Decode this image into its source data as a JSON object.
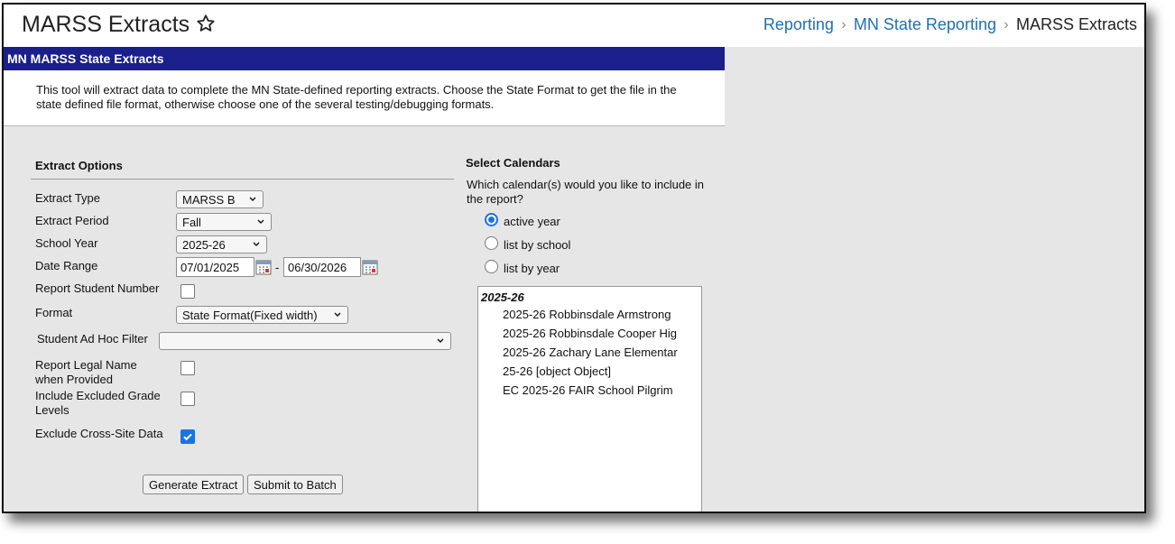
{
  "header": {
    "title": "MARSS Extracts",
    "breadcrumb": [
      "Reporting",
      "MN State Reporting",
      "MARSS Extracts"
    ]
  },
  "panel": {
    "title": "MN MARSS State Extracts",
    "description": "This tool will extract data to complete the MN State-defined reporting extracts. Choose the State Format to get the file in the state defined file format, otherwise choose one of the several testing/debugging formats."
  },
  "extract_options": {
    "section_title": "Extract Options",
    "extract_type": {
      "label": "Extract Type",
      "value": "MARSS B"
    },
    "extract_period": {
      "label": "Extract Period",
      "value": "Fall"
    },
    "school_year": {
      "label": "School Year",
      "value": "2025-26"
    },
    "date_range": {
      "label": "Date Range",
      "start": "07/01/2025",
      "separator": "-",
      "end": "06/30/2026"
    },
    "report_student_number": {
      "label": "Report Student Number",
      "checked": false
    },
    "format": {
      "label": "Format",
      "value": "State Format(Fixed width)"
    },
    "student_ad_hoc_filter": {
      "label": "Student Ad Hoc Filter",
      "value": ""
    },
    "report_legal_name": {
      "label_line1": "Report Legal Name",
      "label_line2": "when Provided",
      "checked": false
    },
    "include_excluded_grade": {
      "label_line1": "Include Excluded Grade",
      "label_line2": "Levels",
      "checked": false
    },
    "exclude_cross_site": {
      "label": "Exclude Cross-Site Data",
      "checked": true
    },
    "buttons": {
      "generate": "Generate Extract",
      "submit": "Submit to Batch"
    }
  },
  "calendars": {
    "section_title": "Select Calendars",
    "question_line1": "Which calendar(s) would you like to include in",
    "question_line2": "the report?",
    "options": [
      "active year",
      "list by school",
      "list by year"
    ],
    "selected_option": "active year",
    "group": "2025-26",
    "items": [
      "2025-26 Robbinsdale Armstrong",
      "2025-26 Robbinsdale Cooper Hig",
      "2025-26 Zachary Lane Elementar",
      "25-26 [object Object]",
      "EC 2025-26 FAIR School Pilgrim"
    ]
  },
  "colors": {
    "panel_header": "#1a1f8c",
    "link": "#1f6fb5",
    "checkbox_checked": "#1a73e8",
    "background": "#e6e6e6"
  },
  "icons": [
    "star-icon",
    "chevron-right-icon",
    "chevron-down-icon",
    "calendar-icon",
    "checkmark-icon"
  ]
}
